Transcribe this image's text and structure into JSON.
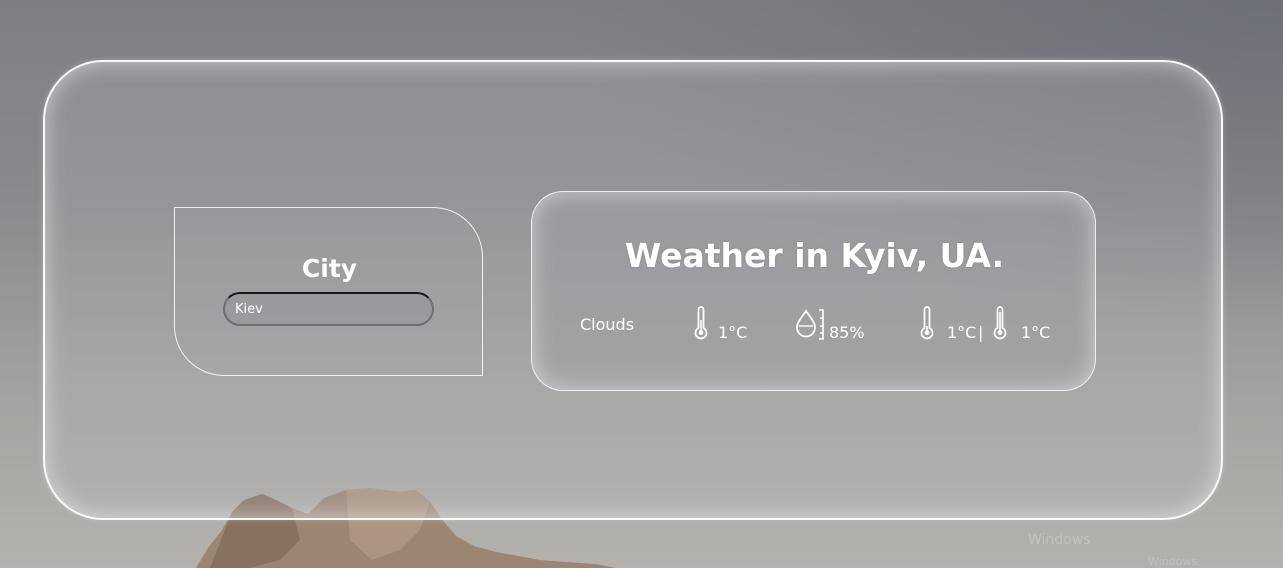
{
  "city_form": {
    "title": "City",
    "input_value": "Kiev"
  },
  "weather": {
    "title": "Weather in Kyiv, UA.",
    "description": "Clouds",
    "temperature": "1°C",
    "humidity": "85%",
    "temp_min": "1°C",
    "separator": "|",
    "temp_max": "1°C",
    "icons": {
      "temperature": "thermometer-icon",
      "humidity": "humidity-drop-icon",
      "temp_min": "thermometer-low-icon",
      "temp_max": "thermometer-high-icon"
    }
  }
}
